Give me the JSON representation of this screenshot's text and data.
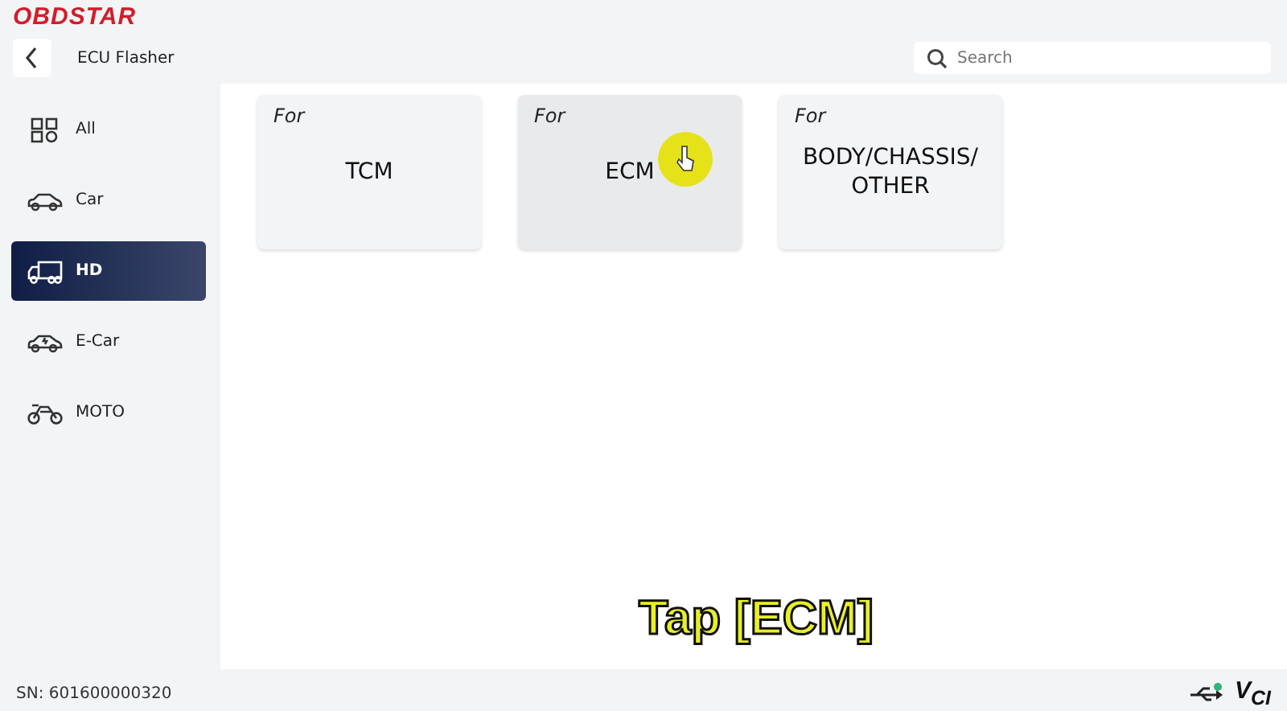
{
  "logo": "OBDSTAR",
  "header": {
    "title": "ECU Flasher",
    "search": {
      "placeholder": "Search"
    }
  },
  "sidebar": {
    "items": [
      {
        "label": "All",
        "kind": "grid",
        "selected": false
      },
      {
        "label": "Car",
        "kind": "car",
        "selected": false
      },
      {
        "label": "HD",
        "kind": "truck",
        "selected": true
      },
      {
        "label": "E-Car",
        "kind": "ecar",
        "selected": false
      },
      {
        "label": "MOTO",
        "kind": "moto",
        "selected": false
      }
    ]
  },
  "cards": [
    {
      "prefix": "For",
      "label": "TCM",
      "selected": false
    },
    {
      "prefix": "For",
      "label": "ECM",
      "selected": true
    },
    {
      "prefix": "For",
      "label": "BODY/CHASSIS/OTHER",
      "selected": false
    }
  ],
  "caption": "Tap [ECM]",
  "status_bar": {
    "serial": "SN: 601600000320",
    "vci": "V$_{CI}$"
  }
}
